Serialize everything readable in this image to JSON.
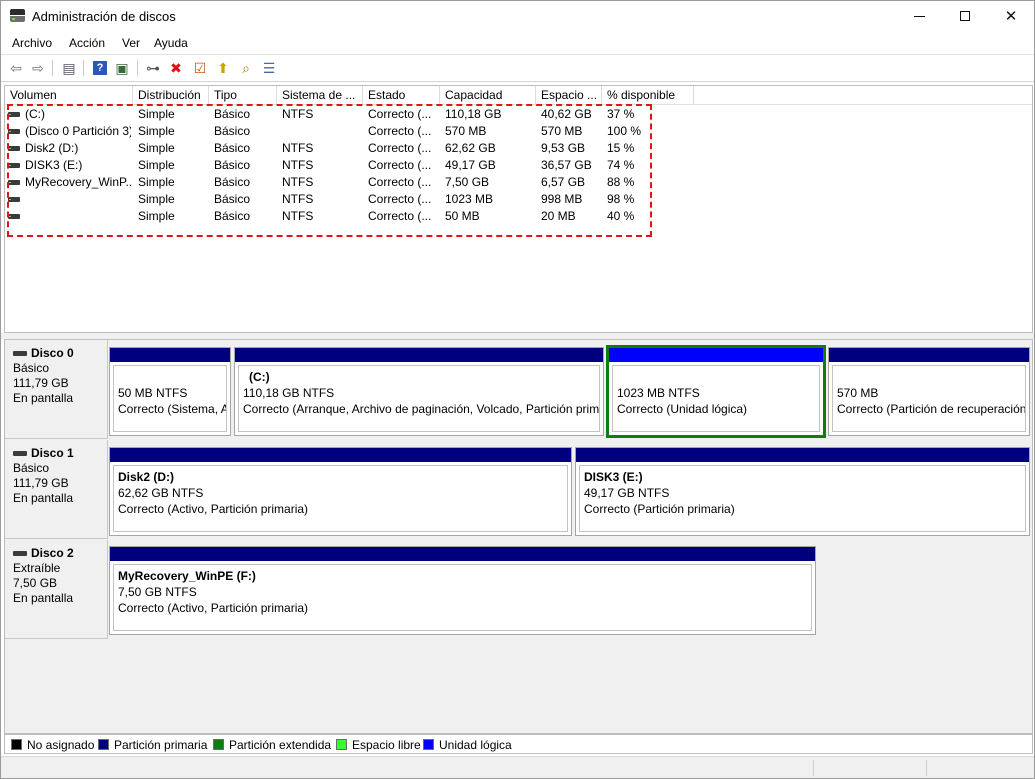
{
  "window": {
    "title": "Administración de discos"
  },
  "menu": [
    "Archivo",
    "Acción",
    "Ver",
    "Ayuda"
  ],
  "toolbar": {
    "icons": [
      "back-icon",
      "forward-icon",
      "list-view-icon",
      "help-icon",
      "properties-icon",
      "connect-drive-icon",
      "delete-icon",
      "check-icon",
      "export-icon",
      "search-icon",
      "settings-list-icon"
    ]
  },
  "volume_table": {
    "headers": [
      "Volumen",
      "Distribución",
      "Tipo",
      "Sistema de ...",
      "Estado",
      "Capacidad",
      "Espacio ...",
      "% disponible"
    ],
    "rows": [
      [
        "(C:)",
        "Simple",
        "Básico",
        "NTFS",
        "Correcto (...",
        "110,18 GB",
        "40,62 GB",
        "37 %"
      ],
      [
        "(Disco 0 Partición 3)",
        "Simple",
        "Básico",
        "",
        "Correcto (...",
        "570 MB",
        "570 MB",
        "100 %"
      ],
      [
        "Disk2 (D:)",
        "Simple",
        "Básico",
        "NTFS",
        "Correcto (...",
        "62,62 GB",
        "9,53 GB",
        "15 %"
      ],
      [
        "DISK3 (E:)",
        "Simple",
        "Básico",
        "NTFS",
        "Correcto (...",
        "49,17 GB",
        "36,57 GB",
        "74 %"
      ],
      [
        "MyRecovery_WinP...",
        "Simple",
        "Básico",
        "NTFS",
        "Correcto (...",
        "7,50 GB",
        "6,57 GB",
        "88 %"
      ],
      [
        "",
        "Simple",
        "Básico",
        "NTFS",
        "Correcto (...",
        "1023 MB",
        "998 MB",
        "98 %"
      ],
      [
        "",
        "Simple",
        "Básico",
        "NTFS",
        "Correcto (...",
        "50 MB",
        "20 MB",
        "40 %"
      ]
    ]
  },
  "disks": [
    {
      "name": "Disco 0",
      "type": "Básico",
      "size": "111,79 GB",
      "status": "En pantalla",
      "partitions": [
        {
          "name": "",
          "size": "50 MB NTFS",
          "status": "Correcto (Sistema, A"
        },
        {
          "name": "(C:)",
          "size": "110,18 GB NTFS",
          "status": "Correcto (Arranque, Archivo de paginación, Volcado, Partición prim"
        },
        {
          "name": "",
          "size": "1023 MB NTFS",
          "status": "Correcto (Unidad lógica)"
        },
        {
          "name": "",
          "size": "570 MB",
          "status": "Correcto (Partición de recuperación"
        }
      ]
    },
    {
      "name": "Disco 1",
      "type": "Básico",
      "size": "111,79 GB",
      "status": "En pantalla",
      "partitions": [
        {
          "name": "Disk2  (D:)",
          "size": "62,62 GB NTFS",
          "status": "Correcto (Activo, Partición primaria)"
        },
        {
          "name": "DISK3  (E:)",
          "size": "49,17 GB NTFS",
          "status": "Correcto (Partición primaria)"
        }
      ]
    },
    {
      "name": "Disco 2",
      "type": "Extraíble",
      "size": "7,50 GB",
      "status": "En pantalla",
      "partitions": [
        {
          "name": "MyRecovery_WinPE  (F:)",
          "size": "7,50 GB NTFS",
          "status": "Correcto (Activo, Partición primaria)"
        }
      ]
    }
  ],
  "legend": [
    {
      "label": "No asignado",
      "color": "#000000"
    },
    {
      "label": "Partición primaria",
      "color": "#00007f"
    },
    {
      "label": "Partición extendida",
      "color": "#107c10"
    },
    {
      "label": "Espacio libre",
      "color": "#33ff33"
    },
    {
      "label": "Unidad lógica",
      "color": "#0000ff"
    }
  ]
}
